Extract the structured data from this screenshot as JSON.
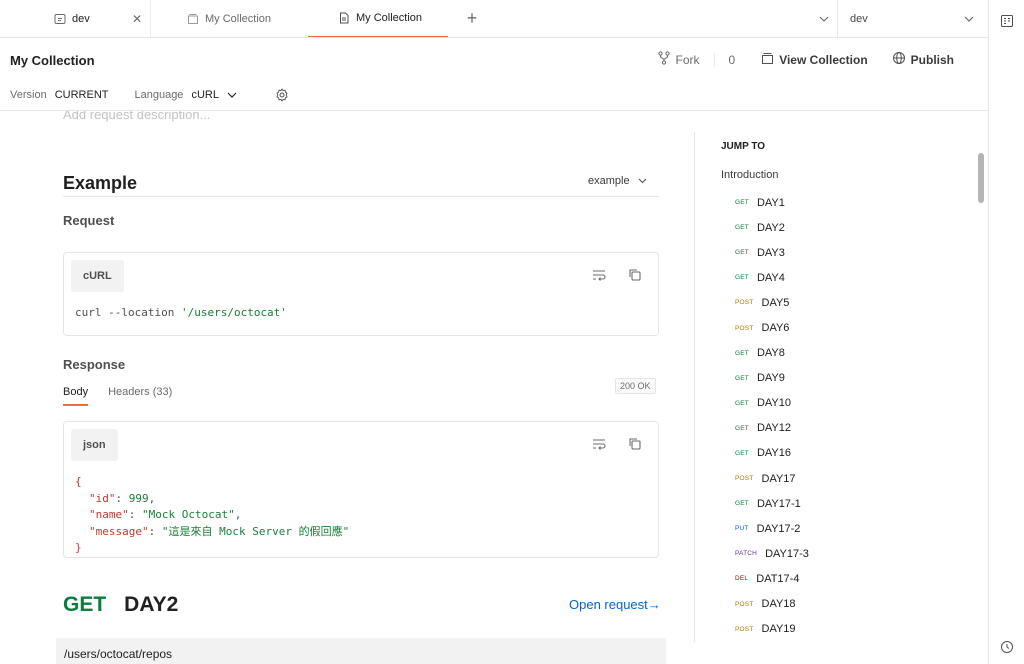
{
  "tabs": [
    {
      "label": "dev",
      "icon": "environment-icon",
      "closable": true
    },
    {
      "label": "My Collection",
      "icon": "collection-icon"
    },
    {
      "label": "My Collection",
      "icon": "document-icon",
      "active": true
    }
  ],
  "environment": {
    "selected": "dev"
  },
  "header": {
    "title": "My Collection",
    "fork_label": "Fork",
    "fork_count": "0",
    "view_collection_label": "View Collection",
    "publish_label": "Publish",
    "version_label": "Version",
    "version_value": "CURRENT",
    "language_label": "Language",
    "language_value": "cURL"
  },
  "doc": {
    "description_placeholder": "Add request description...",
    "example_title": "Example",
    "example_selected": "example",
    "request_heading": "Request",
    "request_lang": "cURL",
    "curl_prefix": "curl --location ",
    "curl_url": "'/users/octocat'",
    "response_heading": "Response",
    "response_tabs": [
      "Body",
      "Headers (33)"
    ],
    "status": "200 OK",
    "response_lang": "json",
    "json": {
      "open": "{",
      "close": "}",
      "lines": [
        {
          "key": "\"id\"",
          "sep": ": ",
          "value": "999",
          "tail": ","
        },
        {
          "key": "\"name\"",
          "sep": ": ",
          "value": "\"Mock Octocat\"",
          "tail": ","
        },
        {
          "key": "\"message\"",
          "sep": ": ",
          "value": "\"這是來自 Mock Server 的假回應\"",
          "tail": ""
        }
      ]
    },
    "next_request": {
      "method": "GET",
      "name": "DAY2",
      "open_label": "Open request→",
      "url": "/users/octocat/repos"
    }
  },
  "jump_to": {
    "title": "JUMP TO",
    "intro": "Introduction",
    "items": [
      {
        "method": "GET",
        "name": "DAY1"
      },
      {
        "method": "GET",
        "name": "DAY2"
      },
      {
        "method": "GET",
        "name": "DAY3"
      },
      {
        "method": "GET",
        "name": "DAY4"
      },
      {
        "method": "POST",
        "name": "DAY5"
      },
      {
        "method": "POST",
        "name": "DAY6"
      },
      {
        "method": "GET",
        "name": "DAY8"
      },
      {
        "method": "GET",
        "name": "DAY9"
      },
      {
        "method": "GET",
        "name": "DAY10"
      },
      {
        "method": "GET",
        "name": "DAY12"
      },
      {
        "method": "GET",
        "name": "DAY16"
      },
      {
        "method": "POST",
        "name": "DAY17"
      },
      {
        "method": "GET",
        "name": "DAY17-1"
      },
      {
        "method": "PUT",
        "name": "DAY17-2"
      },
      {
        "method": "PATCH",
        "name": "DAY17-3"
      },
      {
        "method": "DEL",
        "name": "DAT17-4"
      },
      {
        "method": "POST",
        "name": "DAY18"
      },
      {
        "method": "POST",
        "name": "DAY19"
      }
    ]
  }
}
